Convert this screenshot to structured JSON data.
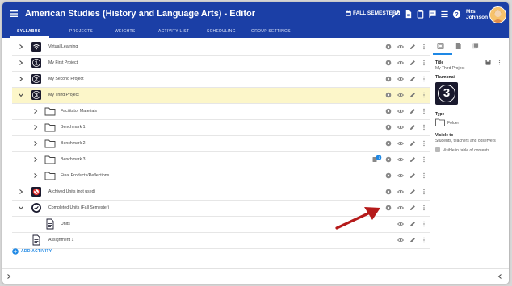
{
  "app": {
    "title": "American Studies (History and Language Arts) - Editor"
  },
  "header": {
    "semester_label": "FALL SEMESTER",
    "user_name_line1": "Mrs.",
    "user_name_line2": "Johnson"
  },
  "tabs": [
    {
      "label": "SYLLABUS",
      "active": true
    },
    {
      "label": "PROJECTS",
      "active": false
    },
    {
      "label": "WEIGHTS",
      "active": false
    },
    {
      "label": "ACTIVITY LIST",
      "active": false
    },
    {
      "label": "SCHEDULING",
      "active": false
    },
    {
      "label": "GROUP SETTINGS",
      "active": false
    }
  ],
  "syllabus": {
    "items": [
      {
        "label": "Virtual Learning",
        "icon": "wifi-icon",
        "expanded": false,
        "level": 0
      },
      {
        "label": "My First Project",
        "icon": "number-1-icon",
        "expanded": false,
        "level": 0
      },
      {
        "label": "My Second Project",
        "icon": "number-2-icon",
        "expanded": false,
        "level": 0
      },
      {
        "label": "My Third Project",
        "icon": "number-3-icon",
        "expanded": true,
        "level": 0,
        "selected": true
      },
      {
        "label": "Facilitator Materials",
        "icon": "folder-icon",
        "expanded": false,
        "level": 1
      },
      {
        "label": "Benchmark 1",
        "icon": "folder-icon",
        "expanded": false,
        "level": 1
      },
      {
        "label": "Benchmark 2",
        "icon": "folder-icon",
        "expanded": false,
        "level": 1
      },
      {
        "label": "Benchmark 3",
        "icon": "folder-icon",
        "expanded": false,
        "level": 1,
        "badge": "3"
      },
      {
        "label": "Final Products/Reflections",
        "icon": "folder-icon",
        "expanded": false,
        "level": 1
      },
      {
        "label": "Archived Units (not used)",
        "icon": "no-entry-icon",
        "expanded": false,
        "level": 0
      },
      {
        "label": "Completed Units (Fall Semester)",
        "icon": "check-badge-icon",
        "expanded": true,
        "level": 0
      },
      {
        "label": "Units",
        "icon": "document-icon",
        "level": 1
      },
      {
        "label": "Assignment 1",
        "icon": "document-icon",
        "level": 0
      }
    ],
    "add_activity_label": "ADD ACTIVITY"
  },
  "details": {
    "title_label": "Title",
    "title_value": "My Third Project",
    "thumbnail_label": "Thumbnail",
    "thumbnail_number": "3",
    "type_label": "Type",
    "type_value": "Folder",
    "visible_label": "Visible to",
    "visible_value": "Students, teachers and observers",
    "toc_label": "Visible in table of contents",
    "toc_checked": true
  },
  "colors": {
    "header_bg": "#1b3fa6",
    "highlight_row": "#fcf6c9",
    "accent": "#1e88e5",
    "arrow": "#b51a1a"
  }
}
